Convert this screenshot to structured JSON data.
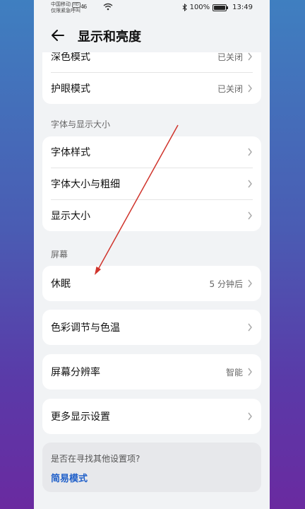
{
  "status": {
    "carrier_line1": "中国移动",
    "carrier_badge": "HD",
    "carrier_line2": "仅限紧急呼叫",
    "signal": "46",
    "battery_text": "100%",
    "time": "13:49"
  },
  "header": {
    "title": "显示和亮度"
  },
  "cards": {
    "top": [
      {
        "label": "深色模式",
        "value": "已关闭"
      },
      {
        "label": "护眼模式",
        "value": "已关闭"
      }
    ],
    "font_section_title": "字体与显示大小",
    "font": [
      {
        "label": "字体样式"
      },
      {
        "label": "字体大小与粗细"
      },
      {
        "label": "显示大小"
      }
    ],
    "screen_section_title": "屏幕",
    "sleep": {
      "label": "休眠",
      "value": "5 分钟后"
    },
    "color": {
      "label": "色彩调节与色温"
    },
    "resolution": {
      "label": "屏幕分辨率",
      "value": "智能"
    },
    "more": {
      "label": "更多显示设置"
    }
  },
  "hint": {
    "question": "是否在寻找其他设置项?",
    "link": "简易模式"
  },
  "colors": {
    "accent_link": "#1f5fc9",
    "annotation_arrow": "#d0342c"
  },
  "icons": [
    "back-arrow-icon",
    "chevron-right-icon",
    "bluetooth-icon",
    "wifi-icon",
    "battery-icon"
  ]
}
